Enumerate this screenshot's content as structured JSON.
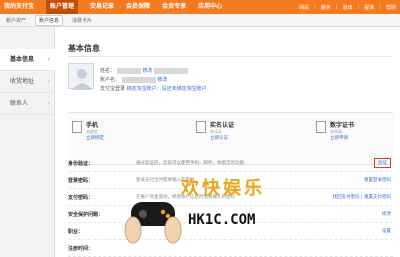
{
  "top_nav": [
    "我的支付宝",
    "账户管理",
    "交易记录",
    "会员保障",
    "会员专享",
    "应用中心"
  ],
  "top_nav_active": 1,
  "top_links": [
    "网站",
    "服务",
    "退出",
    "提体",
    "帮助"
  ],
  "sub_nav": [
    "账户资产",
    "账户信息",
    "消费卡片"
  ],
  "sub_nav_active": 1,
  "sidebar": {
    "items": [
      {
        "label": "基本信息"
      },
      {
        "label": "收货地址"
      },
      {
        "label": "联系人"
      }
    ]
  },
  "main": {
    "title": "基本信息",
    "profile": {
      "name_label": "姓名：",
      "name_link": "修改",
      "account_label": "账户名：",
      "account_link": "修改",
      "login_label": "支付宝登录",
      "login_link": "绑定淘宝账户：没还未绑定淘宝账户"
    },
    "cards": [
      {
        "title": "手机",
        "status": "未绑定",
        "link": "立即绑定"
      },
      {
        "title": "实名认证",
        "status": "未认证",
        "link": "立即认证"
      },
      {
        "title": "数字证书",
        "status": "未申请",
        "link": "立即申请"
      }
    ],
    "rows": [
      {
        "label": "身份验证：",
        "desc": "通过验证后，您就可以使用手机：邮件，余额宝的功能",
        "action": "验证"
      },
      {
        "label": "登录密码：",
        "desc": "登录支付宝时需要输入的密码",
        "action": "重置登录密码"
      },
      {
        "label": "支付密码：",
        "desc": "在账户资金变动，修改账户信息时需要输入的密码",
        "action": "找回支付密码 | 重置支付密码"
      },
      {
        "label": "安全保护问题：",
        "desc": "",
        "action": "修改"
      },
      {
        "label": "职业：",
        "desc": "",
        "action": "设置"
      },
      {
        "label": "注册时间：",
        "desc": "",
        "action": ""
      }
    ]
  },
  "watermark": {
    "cn": "欢快娱乐",
    "en": "HK1C.COM"
  },
  "colors": {
    "brand": "#f47b20",
    "link": "#2f6fcf",
    "highlight_border": "#e03a2f",
    "watermark_gold": "#e8a41c"
  }
}
